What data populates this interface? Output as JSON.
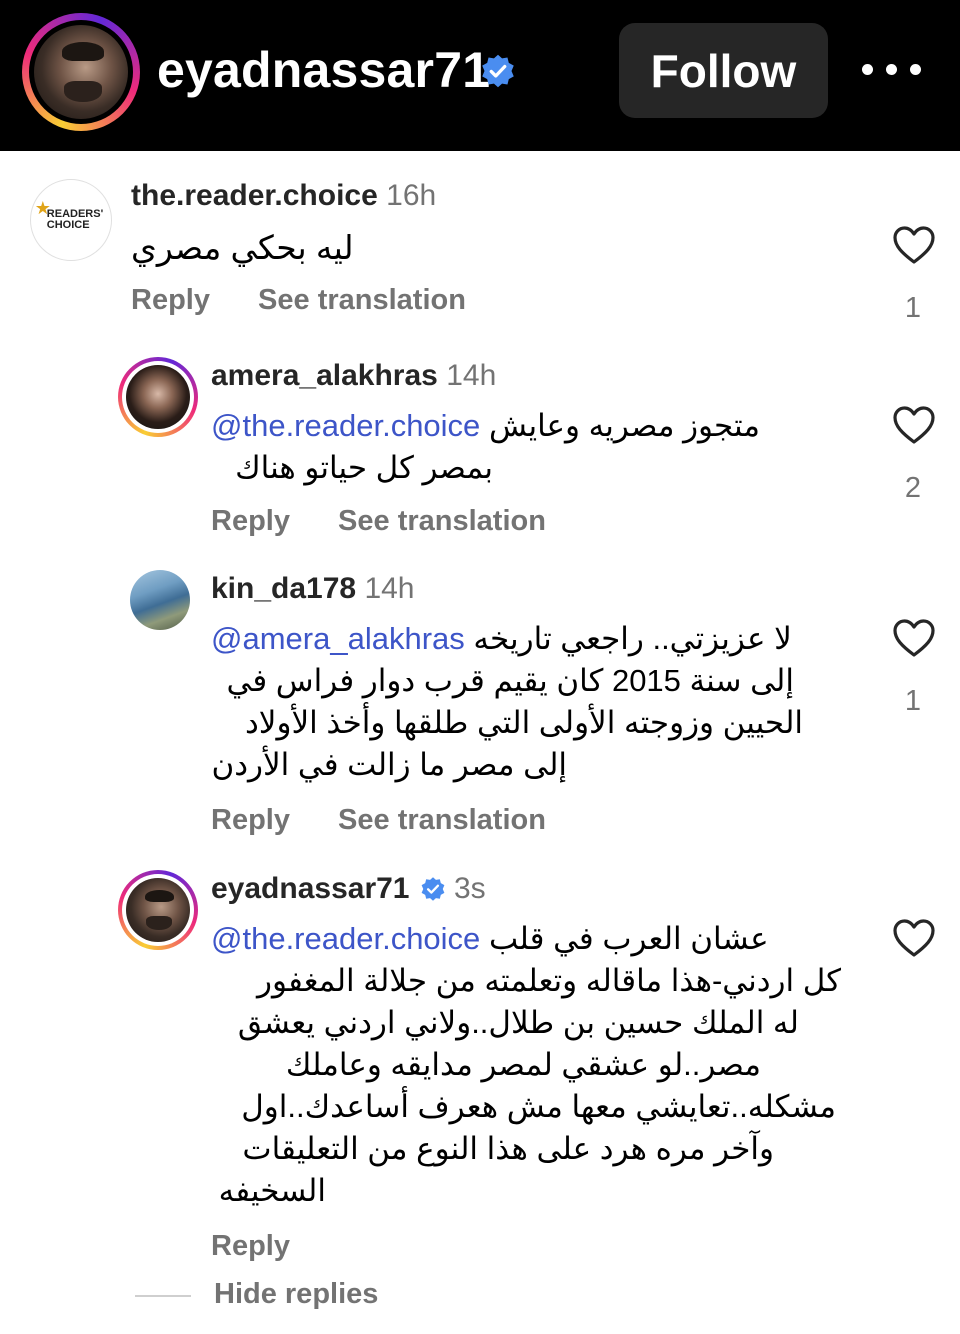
{
  "header": {
    "username": "eyadnassar71",
    "follow_label": "Follow"
  },
  "comments": [
    {
      "username": "the.reader.choice",
      "time": "16h",
      "avatar_text": "READERS' CHOICE",
      "mention": "",
      "text": "ليه بحكي مصري",
      "reply_label": "Reply",
      "translation_label": "See translation",
      "likes": "1"
    },
    {
      "username": "amera_alakhras",
      "time": "14h",
      "mention": "@the.reader.choice",
      "text_line1": "متجوز مصريه وعايش",
      "text_line2": "بمصر كل حياتو هناك",
      "reply_label": "Reply",
      "translation_label": "See translation",
      "likes": "2"
    },
    {
      "username": "kin_da178",
      "time": "14h",
      "mention": "@amera_alakhras",
      "text_line1": "لا عزيزتي.. راجعي تاريخه",
      "text_line2": "إلى سنة 2015 كان يقيم قرب دوار فراس في",
      "text_line3": "الحيين وزوجته الأولى التي طلقها وأخذ الأولاد",
      "text_line4": "إلى مصر ما زالت في الأردن",
      "reply_label": "Reply",
      "translation_label": "See translation",
      "likes": "1"
    },
    {
      "username": "eyadnassar71",
      "time": "3s",
      "mention": "@the.reader.choice",
      "text_line1": "عشان العرب في قلب",
      "text_line2": "كل اردني-هذا ماقاله وتعلمته من جلالة المغفور",
      "text_line3": "له الملك حسين بن طلال..ولاني اردني يعشق",
      "text_line4": "مصر..لو عشقي لمصر مدايقه وعاملك",
      "text_line5": "مشكله..تعايشي معها مش هعرف أساعدك..اول",
      "text_line6": "وآخر مره هرد على هذا النوع من التعليقات",
      "text_line7": "السخيفه",
      "reply_label": "Reply"
    }
  ],
  "hide_replies_label": "Hide replies",
  "colors": {
    "mention": "#3d55c8",
    "secondary_text": "#737373",
    "verified": "#4a8df0",
    "follow_button": "#262626"
  },
  "icons": [
    "verified-badge-icon",
    "more-icon",
    "heart-icon"
  ]
}
